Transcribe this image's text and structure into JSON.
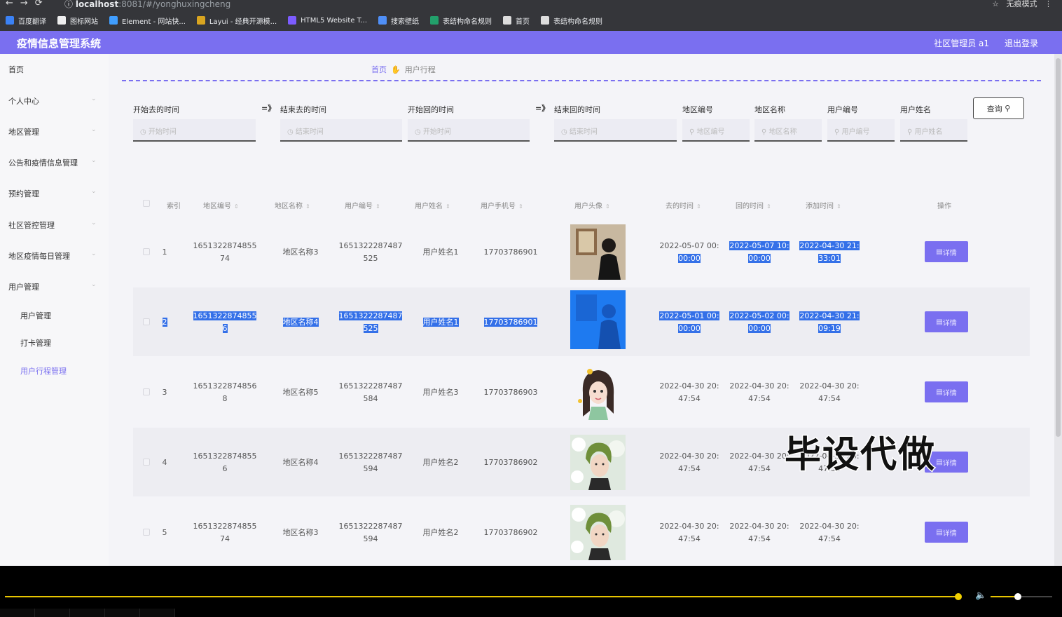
{
  "browser": {
    "url_host": "localhost",
    "url_rest": ":8081/#/yonghuxingcheng",
    "profile_label": "无痕模式",
    "bookmarks": [
      {
        "label": "百度翻译",
        "color": "#3b82f6"
      },
      {
        "label": "图标网站",
        "color": "#eeeeee"
      },
      {
        "label": "Element - 网站快...",
        "color": "#409eff"
      },
      {
        "label": "Layui - 经典开源模...",
        "color": "#d9a520"
      },
      {
        "label": "HTML5 Website T...",
        "color": "#7c5cff"
      },
      {
        "label": "搜索壁纸",
        "color": "#4f8ff7"
      },
      {
        "label": "表结构命名规则",
        "color": "#22a06b"
      },
      {
        "label": "首页",
        "color": "#dddddd"
      },
      {
        "label": "表结构命名规则",
        "color": "#dddddd"
      }
    ]
  },
  "header": {
    "title": "疫情信息管理系统",
    "user": "社区管理员 a1",
    "logout": "退出登录"
  },
  "sidebar": {
    "items": [
      {
        "label": "首页",
        "has_children": false
      },
      {
        "label": "个人中心",
        "has_children": true
      },
      {
        "label": "地区管理",
        "has_children": true
      },
      {
        "label": "公告和疫情信息管理",
        "has_children": true
      },
      {
        "label": "预约管理",
        "has_children": true
      },
      {
        "label": "社区管控管理",
        "has_children": true
      },
      {
        "label": "地区疫情每日管理",
        "has_children": true
      },
      {
        "label": "用户管理",
        "has_children": true
      }
    ],
    "sub_items": [
      {
        "label": "用户管理",
        "active": false
      },
      {
        "label": "打卡管理",
        "active": false
      },
      {
        "label": "用户行程管理",
        "active": true
      }
    ]
  },
  "breadcrumb": {
    "home": "首页",
    "current": "用户行程"
  },
  "filters": {
    "start_go_label": "开始去的时间",
    "end_go_label": "结束去的时间",
    "start_back_label": "开始回的时间",
    "end_back_label": "结束回的时间",
    "region_code_label": "地区编号",
    "region_name_label": "地区名称",
    "user_code_label": "用户编号",
    "user_name_label": "用户姓名",
    "start_placeholder": "开始时间",
    "end_placeholder": "结束时间",
    "region_code_placeholder": "地区编号",
    "region_name_placeholder": "地区名称",
    "user_code_placeholder": "用户编号",
    "user_name_placeholder": "用户姓名",
    "range_arrow": "=》",
    "query_button": "查询"
  },
  "table": {
    "columns": [
      "索引",
      "地区编号",
      "地区名称",
      "用户编号",
      "用户姓名",
      "用户手机号",
      "用户头像",
      "去的时间",
      "回的时间",
      "添加时间",
      "操作"
    ],
    "detail_label": "详情",
    "rows": [
      {
        "index": "1",
        "region_code": [
          "1651322874855",
          "74"
        ],
        "region_name": "地区名称3",
        "user_code": [
          "1651322287487",
          "525"
        ],
        "user_name": "用户姓名1",
        "phone": "17703786901",
        "avatar": "man-painting",
        "go_time": [
          "2022-05-07 00:",
          "00:00"
        ],
        "back_time": [
          "2022-05-07 10:",
          "00:00"
        ],
        "add_time": [
          "2022-04-30 21:",
          "33:01"
        ],
        "hl": "partial"
      },
      {
        "index": "2",
        "region_code": [
          "1651322874855",
          "6"
        ],
        "region_name": "地区名称4",
        "user_code": [
          "1651322287487",
          "525"
        ],
        "user_name": "用户姓名1",
        "phone": "17703786901",
        "avatar": "man-painting-blue",
        "go_time": [
          "2022-05-01 00:",
          "00:00"
        ],
        "back_time": [
          "2022-05-02 00:",
          "00:00"
        ],
        "add_time": [
          "2022-04-30 21:",
          "09:19"
        ],
        "hl": "full"
      },
      {
        "index": "3",
        "region_code": [
          "1651322874856",
          "8"
        ],
        "region_name": "地区名称5",
        "user_code": [
          "1651322287487",
          "584"
        ],
        "user_name": "用户姓名3",
        "phone": "17703786903",
        "avatar": "cartoon-girl",
        "go_time": [
          "2022-04-30 20:",
          "47:54"
        ],
        "back_time": [
          "2022-04-30 20:",
          "47:54"
        ],
        "add_time": [
          "2022-04-30 20:",
          "47:54"
        ],
        "hl": "none"
      },
      {
        "index": "4",
        "region_code": [
          "1651322874855",
          "6"
        ],
        "region_name": "地区名称4",
        "user_code": [
          "1651322287487",
          "594"
        ],
        "user_name": "用户姓名2",
        "phone": "17703786902",
        "avatar": "boy-flowers",
        "go_time": [
          "2022-04-30 20:",
          "47:54"
        ],
        "back_time": [
          "2022-04-30 20:",
          "47:54"
        ],
        "add_time": [
          "2022-04-30 20:",
          "47:54"
        ],
        "hl": "none"
      },
      {
        "index": "5",
        "region_code": [
          "1651322874855",
          "74"
        ],
        "region_name": "地区名称3",
        "user_code": [
          "1651322287487",
          "594"
        ],
        "user_name": "用户姓名2",
        "phone": "17703786902",
        "avatar": "boy-flowers",
        "go_time": [
          "2022-04-30 20:",
          "47:54"
        ],
        "back_time": [
          "2022-04-30 20:",
          "47:54"
        ],
        "add_time": [
          "2022-04-30 20:",
          "47:54"
        ],
        "hl": "none"
      }
    ]
  },
  "watermark": "毕设代做",
  "player": {
    "progress": 0.9,
    "volume": 0.45
  },
  "colors": {
    "accent": "#7a6ff0",
    "selection": "#3470e8",
    "player": "#e8c500"
  }
}
